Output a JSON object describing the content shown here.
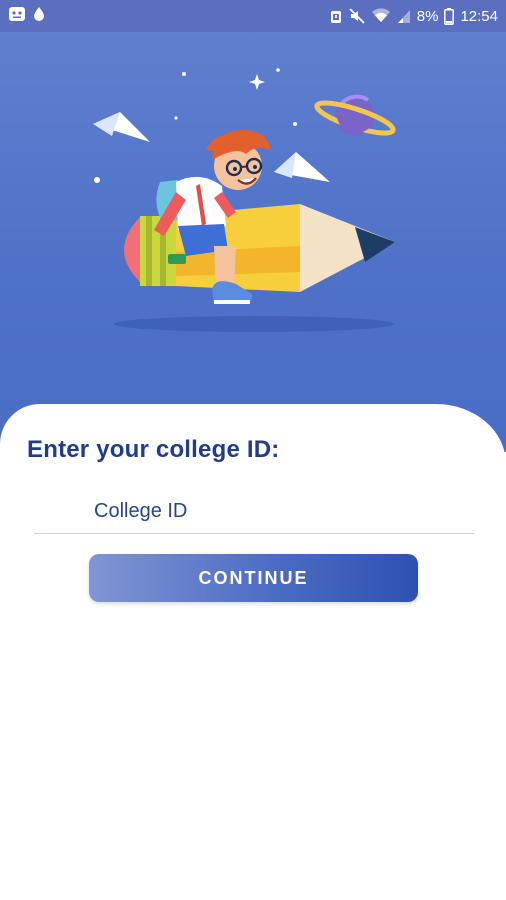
{
  "status_bar": {
    "battery_percent": "8%",
    "time": "12:54",
    "icons_left": [
      "app-notification-icon",
      "water-drop-icon"
    ],
    "icons_right": [
      "alarm-icon",
      "mute-icon",
      "wifi-icon",
      "signal-icon",
      "battery-icon"
    ]
  },
  "login": {
    "title": "Enter your college ID:",
    "input_placeholder": "College ID",
    "input_value": "",
    "continue_label": "CONTINUE"
  },
  "colors": {
    "hero_bg": "#5073c7",
    "title_text": "#1f3c8f",
    "button_start": "#8095d4",
    "button_end": "#2e50b1"
  },
  "illustration": {
    "subject": "boy-riding-pencil",
    "elements": [
      "paper-plane-icon",
      "planet-icon",
      "sparkle-icon"
    ]
  }
}
